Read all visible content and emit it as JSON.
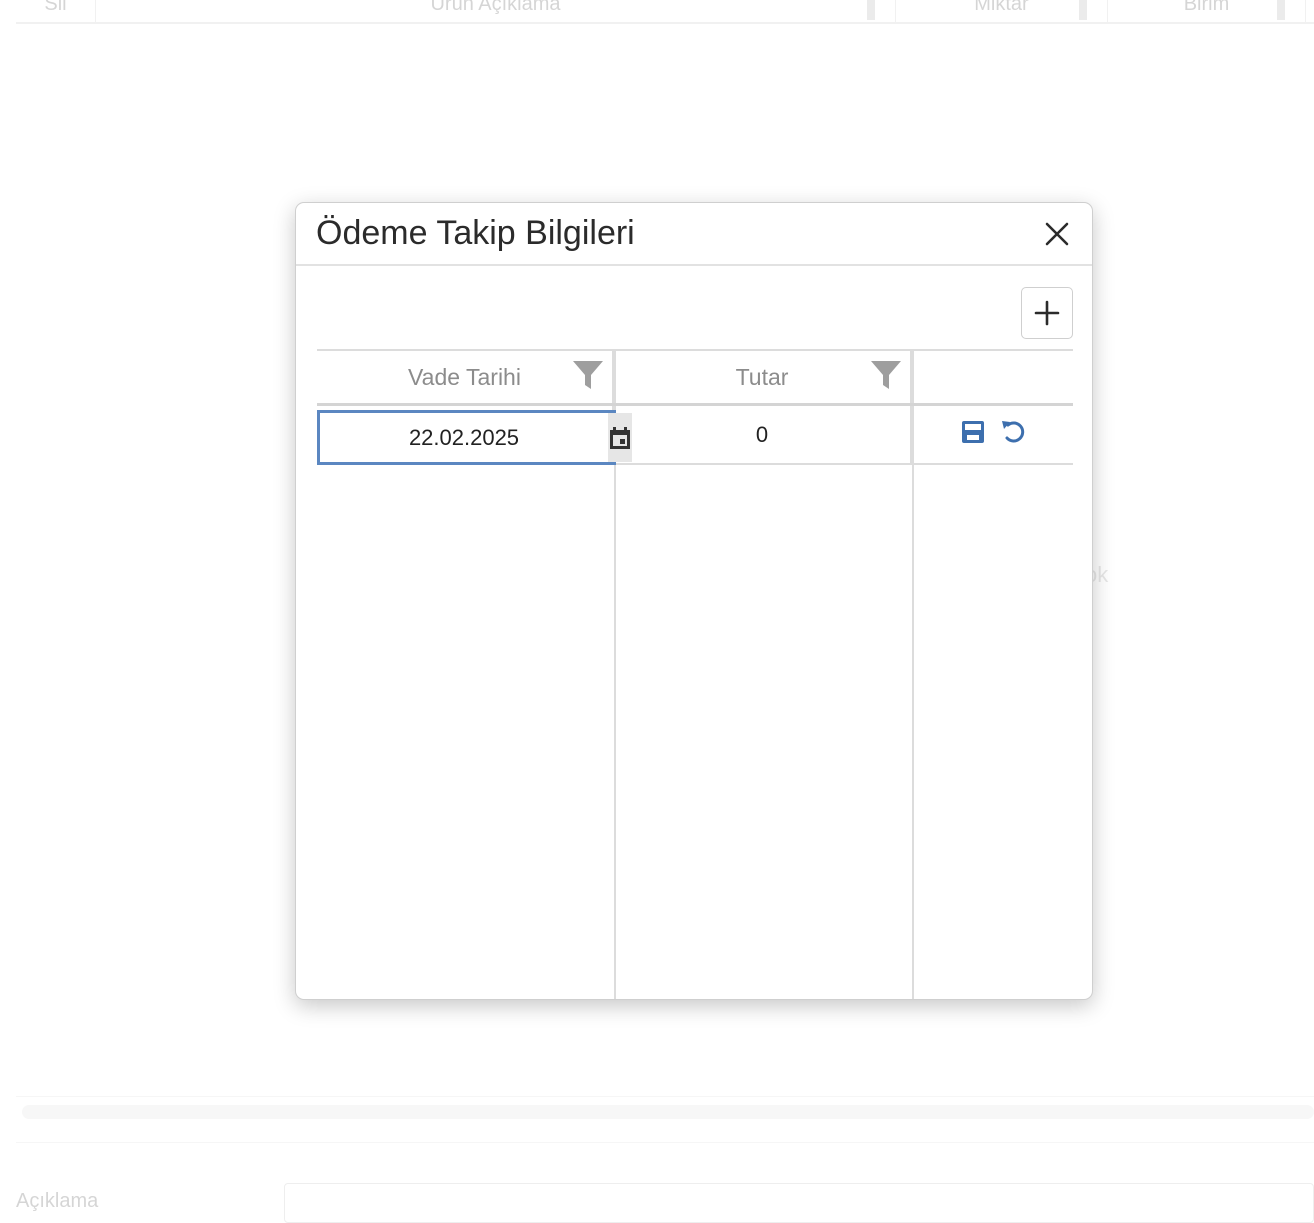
{
  "background": {
    "grid_columns": [
      "Sil",
      "Ürün Açıklama",
      "Miktar",
      "Birim"
    ],
    "empty_text": "ok",
    "bottom_label": "Açıklama"
  },
  "modal": {
    "title": "Ödeme Takip Bilgileri",
    "close_icon": "close-icon",
    "add_icon": "plus-icon",
    "grid": {
      "columns": [
        {
          "label": "Vade Tarihi",
          "filter_icon": "filter-icon"
        },
        {
          "label": "Tutar",
          "filter_icon": "filter-icon"
        },
        {
          "label": ""
        }
      ],
      "rows": [
        {
          "vade_tarihi": "22.02.2025",
          "tutar": "0",
          "actions": [
            "save-icon",
            "undo-icon"
          ]
        }
      ]
    }
  },
  "colors": {
    "accent": "#5b87c1",
    "icon_blue": "#3d6fae",
    "filter_gray": "#9e9e9e"
  }
}
